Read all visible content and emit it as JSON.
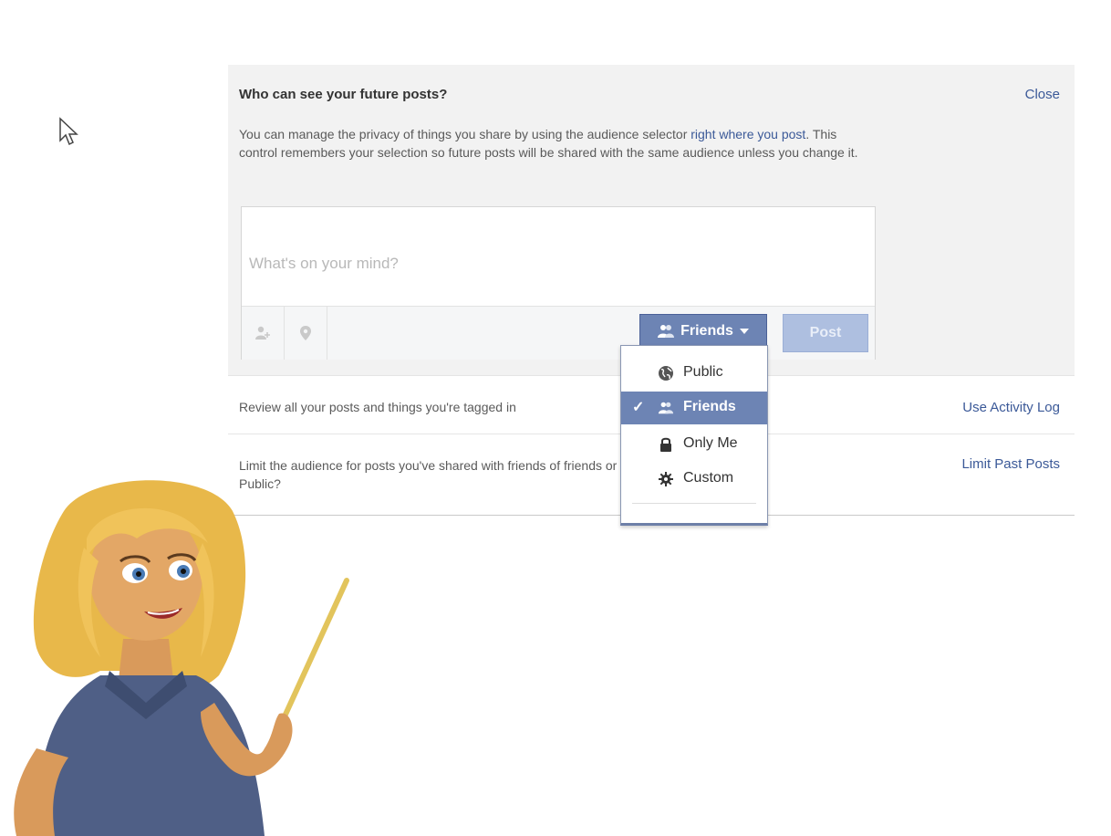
{
  "panel": {
    "title": "Who can see your future posts?",
    "close_label": "Close",
    "desc_part1": "You can manage the privacy of things you share by using the audience selector ",
    "desc_link": "right where you post",
    "desc_part2": ". This control remembers your selection so future posts will be shared with the same audience unless you change it."
  },
  "composer": {
    "placeholder": "What's on your mind?",
    "tag_icon": "tag-people-icon",
    "location_icon": "location-pin-icon",
    "audience_label": "Friends",
    "post_label": "Post"
  },
  "rows": {
    "activity_text": "Review all your posts and things you're tagged in",
    "activity_link": "Use Activity Log",
    "limit_text": "Limit the audience for posts you've shared with friends of friends or Public?",
    "limit_link": "Limit Past Posts"
  },
  "audience_menu": {
    "items": [
      {
        "label": "Public",
        "icon": "globe-icon",
        "selected": false
      },
      {
        "label": "Friends",
        "icon": "friends-icon",
        "selected": true
      },
      {
        "label": "Only Me",
        "icon": "lock-icon",
        "selected": false
      },
      {
        "label": "Custom",
        "icon": "gear-icon",
        "selected": false
      }
    ],
    "check_mark": "✓"
  },
  "colors": {
    "brand": "#3b5998",
    "selector": "#6d84b4",
    "post_disabled": "#aebfe0",
    "panel_bg": "#f2f2f2"
  }
}
